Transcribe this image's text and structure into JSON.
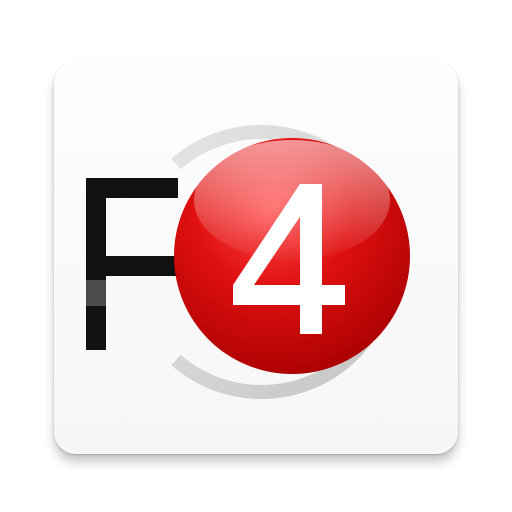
{
  "app_icon": {
    "glyph_letter": "F",
    "glyph_number": "4",
    "colors": {
      "tile_background": "#f7f7f7",
      "letter": "#111111",
      "ring": "#d0d0d0",
      "badge_red": "#d60000",
      "badge_highlight": "#ff7a7a",
      "number": "#ffffff"
    }
  }
}
